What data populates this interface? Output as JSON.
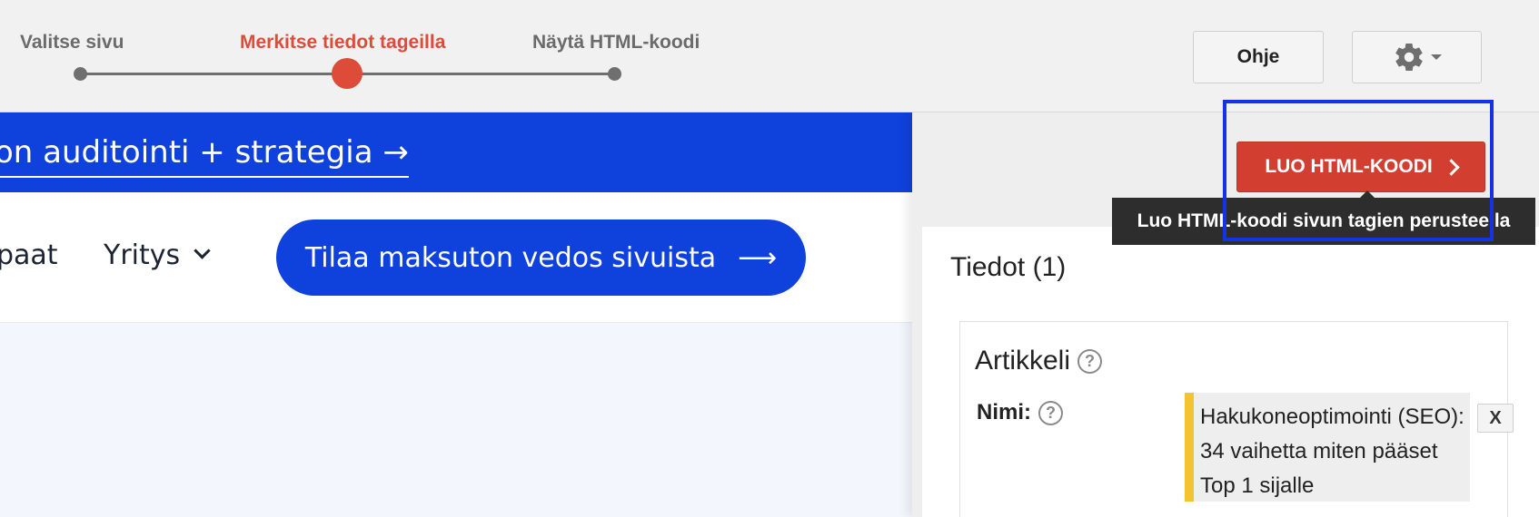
{
  "wizard": {
    "steps": [
      {
        "label": "Valitse sivu",
        "state": "done"
      },
      {
        "label": "Merkitse tiedot tageilla",
        "state": "active"
      },
      {
        "label": "Näytä HTML-koodi",
        "state": "pending"
      }
    ],
    "help_label": "Ohje",
    "settings_icon": "gear-icon"
  },
  "web_page": {
    "banner_link": "on auditointi + strategia →",
    "nav_items": [
      "paat",
      "Yritys"
    ],
    "cta_label": "Tilaa maksuton vedos sivuista",
    "cta_arrow": "⟶"
  },
  "panel": {
    "create_button": "LUO HTML-KOODI",
    "tooltip": "Luo HTML-koodi sivun tagien perusteella",
    "data_title": "Tiedot (1)",
    "item": {
      "type": "Artikkeli",
      "field_label": "Nimi:",
      "field_value": "Hakukoneoptimointi (SEO): 34 vaihetta miten pääset Top 1 sijalle",
      "remove_label": "X"
    }
  },
  "colors": {
    "accent_red": "#dd4b39",
    "site_blue": "#0f41dc",
    "highlight_blue": "#1432e6",
    "tag_yellow": "#f4c430"
  }
}
